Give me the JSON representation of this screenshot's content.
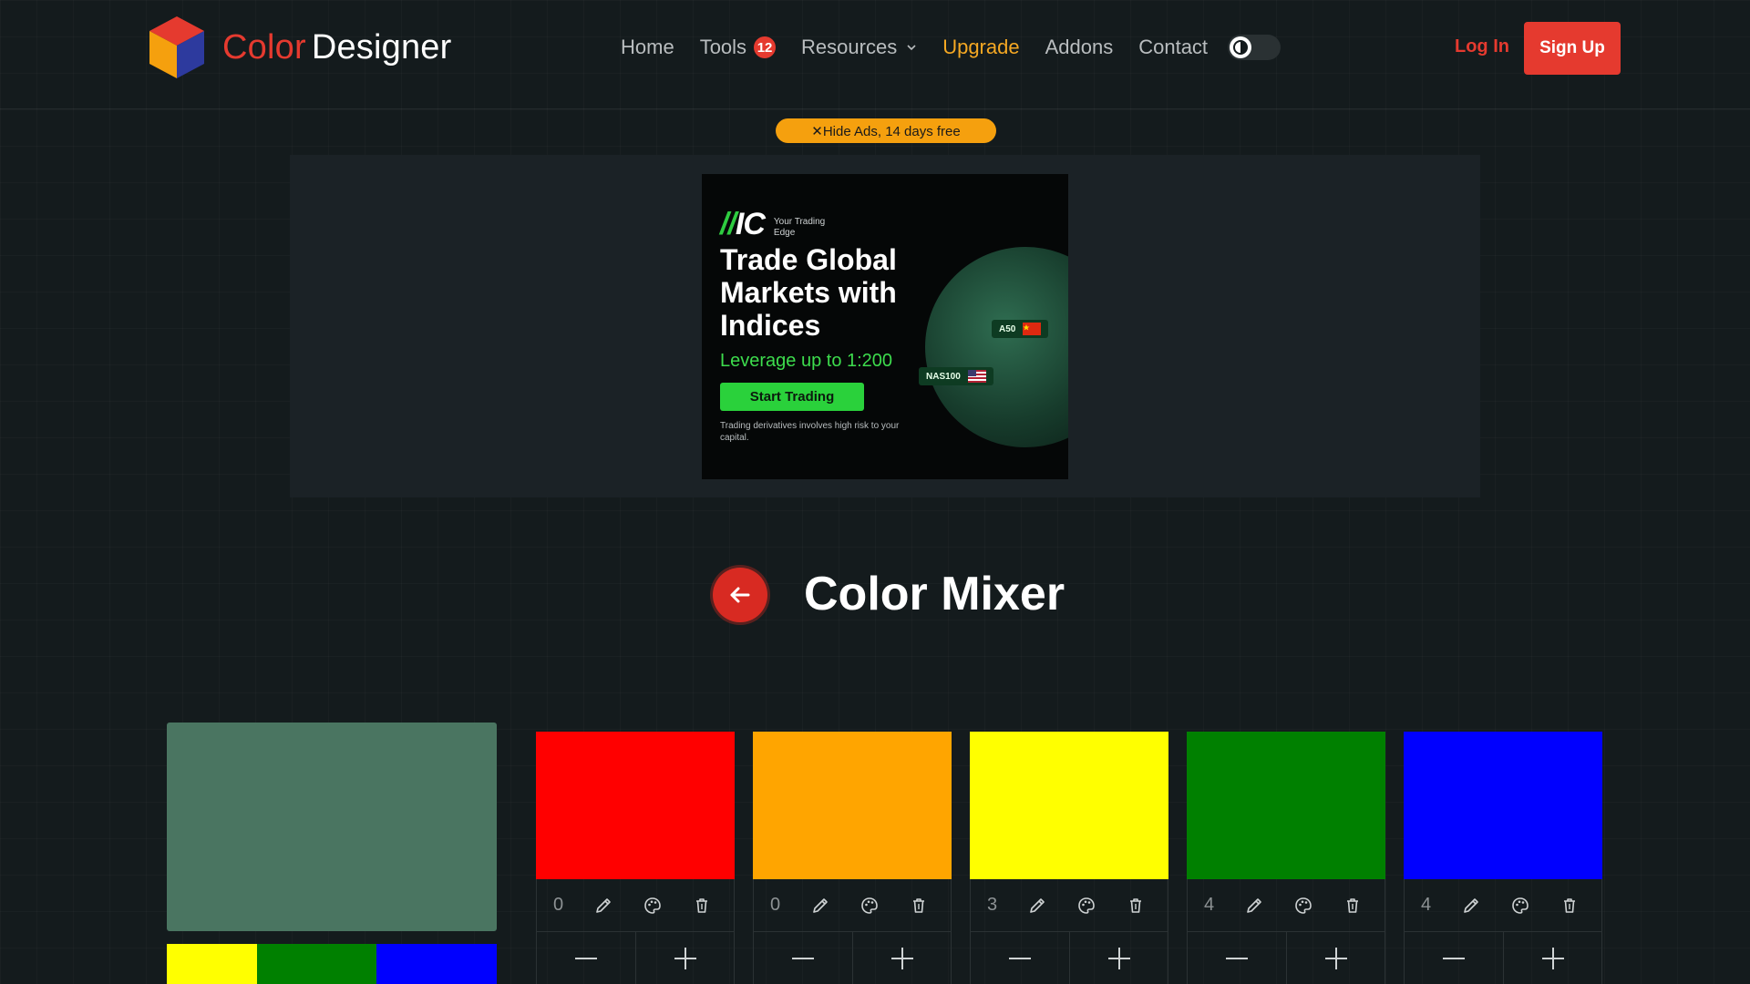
{
  "header": {
    "logo_part1": "Color",
    "logo_part2": "Designer",
    "logo_icon": "cube-logo-icon",
    "nav": [
      {
        "label": "Home"
      },
      {
        "label": "Tools",
        "badge": "12"
      },
      {
        "label": "Resources",
        "icon": "chevron-down-icon"
      },
      {
        "label": "Upgrade"
      },
      {
        "label": "Addons"
      },
      {
        "label": "Contact"
      }
    ],
    "theme_toggle_icon": "contrast-icon",
    "login_label": "Log In",
    "signup_label": "Sign Up"
  },
  "ads": {
    "hide_label": "✕Hide Ads, 14 days free",
    "banner": {
      "brand": "IC",
      "brand_tagline": "Your Trading Edge",
      "headline": "Trade Global Markets with Indices",
      "subline": "Leverage up to 1:200",
      "cta": "Start Trading",
      "disclaimer": "Trading derivatives involves high risk to your capital.",
      "tag1": "A50",
      "tag2": "NAS100"
    }
  },
  "page": {
    "title": "Color Mixer",
    "back_icon": "arrow-left-icon"
  },
  "mixer": {
    "result_color": "#4a7561",
    "result_bar": [
      {
        "color": "#ffff00",
        "parts": 3
      },
      {
        "color": "#008000",
        "parts": 4
      },
      {
        "color": "#0000ff",
        "parts": 4
      }
    ],
    "colors": [
      {
        "hex": "#ff0000",
        "count": "0"
      },
      {
        "hex": "#ffa500",
        "count": "0"
      },
      {
        "hex": "#ffff00",
        "count": "3"
      },
      {
        "hex": "#008000",
        "count": "4"
      },
      {
        "hex": "#0000ff",
        "count": "4"
      }
    ],
    "control_icons": [
      "pencil-icon",
      "palette-icon",
      "trash-icon"
    ],
    "stepper_icons": [
      "minus-icon",
      "plus-icon"
    ]
  },
  "colors": {
    "accent": "#e53a2f",
    "upgrade": "#f5a823",
    "ad_pill": "#f5a00e"
  }
}
